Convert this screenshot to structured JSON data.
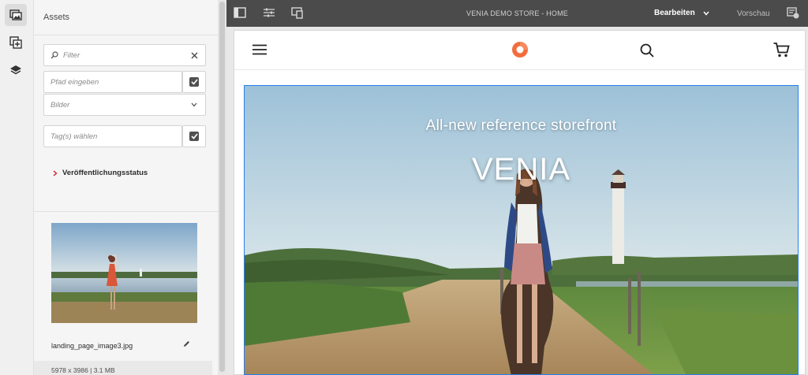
{
  "sidebar": {
    "title": "Assets",
    "filter": {
      "placeholder": "Filter"
    },
    "path": {
      "placeholder": "Pfad eingeben"
    },
    "type_select": {
      "value": "Bilder"
    },
    "tags": {
      "placeholder": "Tag(s) wählen"
    },
    "publish_status": {
      "label": "Veröffentlichungsstatus"
    },
    "asset": {
      "name": "landing_page_image3.jpg",
      "meta": "5978 x 3986 | 3.1 MB"
    }
  },
  "topbar": {
    "title": "VENIA DEMO STORE - HOME",
    "edit_label": "Bearbeiten",
    "preview_label": "Vorschau"
  },
  "hero": {
    "subtitle": "All-new reference storefront",
    "title": "VENIA"
  },
  "colors": {
    "selection_border": "#2680eb",
    "brand_orange": "#f26d3d",
    "topbar_bg": "#4b4b4b"
  },
  "icons": [
    "assets-icon",
    "components-icon",
    "layers-icon",
    "search-icon",
    "close-icon",
    "checkbox-icon",
    "chevron-down-icon",
    "chevron-right-icon",
    "pencil-icon",
    "side-panel-icon",
    "page-properties-icon",
    "emulator-icon",
    "annotations-icon",
    "hamburger-menu-icon",
    "venia-logo-icon",
    "cart-icon"
  ]
}
